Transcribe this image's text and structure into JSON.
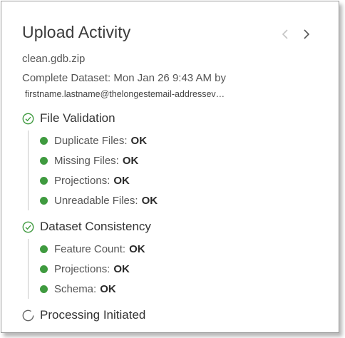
{
  "panel": {
    "title": "Upload Activity",
    "file_name": "clean.gdb.zip",
    "completed_text": "Complete Dataset: Mon Jan 26 9:43 AM by",
    "email": "firstname.lastname@thelongestemail-addressev…"
  },
  "colors": {
    "status_ok": "#3f9a3f",
    "text_primary": "#333333",
    "text_secondary": "#555555",
    "in_progress": "#666666"
  },
  "sections": [
    {
      "title": "File Validation",
      "state": "complete",
      "icon": "check-circle-icon",
      "checks": [
        {
          "label": "Duplicate Files:",
          "status": "OK"
        },
        {
          "label": "Missing Files:",
          "status": "OK"
        },
        {
          "label": "Projections:",
          "status": "OK"
        },
        {
          "label": "Unreadable Files:",
          "status": "OK"
        }
      ]
    },
    {
      "title": "Dataset Consistency",
      "state": "complete",
      "icon": "check-circle-icon",
      "checks": [
        {
          "label": "Feature Count:",
          "status": "OK"
        },
        {
          "label": "Projections:",
          "status": "OK"
        },
        {
          "label": "Schema:",
          "status": "OK"
        }
      ]
    },
    {
      "title": "Processing Initiated",
      "state": "in-progress",
      "icon": "spinner-icon",
      "checks": []
    }
  ],
  "nav": {
    "prev_icon": "chevron-left-icon",
    "next_icon": "chevron-right-icon"
  }
}
